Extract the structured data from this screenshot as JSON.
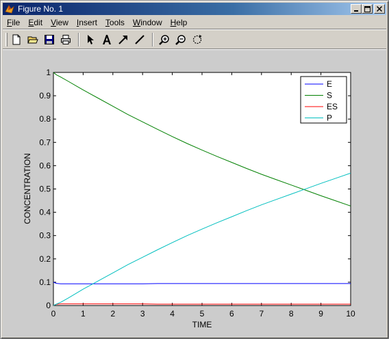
{
  "window": {
    "title": "Figure No. 1",
    "controls": {
      "minimize": "_",
      "maximize": "□",
      "close": "×"
    }
  },
  "menubar": {
    "items": [
      {
        "label": "File",
        "accel": "F"
      },
      {
        "label": "Edit",
        "accel": "E"
      },
      {
        "label": "View",
        "accel": "V"
      },
      {
        "label": "Insert",
        "accel": "I"
      },
      {
        "label": "Tools",
        "accel": "T"
      },
      {
        "label": "Window",
        "accel": "W"
      },
      {
        "label": "Help",
        "accel": "H"
      }
    ]
  },
  "toolbar": {
    "tools": [
      "new-file-icon",
      "open-folder-icon",
      "save-icon",
      "print-icon",
      "select-arrow-icon",
      "insert-text-icon",
      "insert-arrow-icon",
      "insert-line-icon",
      "zoom-in-icon",
      "zoom-out-icon",
      "rotate-icon"
    ]
  },
  "colors": {
    "E": "#0000ff",
    "S": "#008000",
    "ES": "#ff0000",
    "P": "#00bfbf",
    "figure_bg": "#cccccc",
    "axes_bg": "#ffffff"
  },
  "chart_data": {
    "type": "line",
    "title": "",
    "xlabel": "TIME",
    "ylabel": "CONCENTRATION",
    "xlim": [
      0,
      10
    ],
    "ylim": [
      0,
      1
    ],
    "xticks": [
      "0",
      "1",
      "2",
      "3",
      "4",
      "5",
      "6",
      "7",
      "8",
      "9",
      "10"
    ],
    "yticks": [
      "0",
      "0.1",
      "0.2",
      "0.3",
      "0.4",
      "0.5",
      "0.6",
      "0.7",
      "0.8",
      "0.9",
      "1"
    ],
    "legend_position": "top-right",
    "grid": false,
    "x": [
      0,
      0.1,
      0.25,
      0.5,
      1,
      1.5,
      2,
      2.5,
      3,
      3.5,
      4,
      4.5,
      5,
      5.5,
      6,
      6.5,
      7,
      7.5,
      8,
      8.5,
      9,
      9.5,
      10
    ],
    "series": [
      {
        "name": "E",
        "color": "#0000ff",
        "values": [
          0.1,
          0.095,
          0.093,
          0.093,
          0.093,
          0.093,
          0.093,
          0.093,
          0.093,
          0.094,
          0.094,
          0.094,
          0.094,
          0.094,
          0.094,
          0.094,
          0.094,
          0.094,
          0.094,
          0.094,
          0.094,
          0.094,
          0.094
        ]
      },
      {
        "name": "S",
        "color": "#008000",
        "values": [
          1.0,
          0.99,
          0.98,
          0.962,
          0.925,
          0.89,
          0.855,
          0.82,
          0.788,
          0.756,
          0.725,
          0.695,
          0.667,
          0.64,
          0.614,
          0.588,
          0.563,
          0.54,
          0.517,
          0.494,
          0.471,
          0.449,
          0.427
        ]
      },
      {
        "name": "ES",
        "color": "#ff0000",
        "values": [
          0.0,
          0.005,
          0.007,
          0.007,
          0.007,
          0.007,
          0.007,
          0.007,
          0.007,
          0.006,
          0.006,
          0.006,
          0.006,
          0.006,
          0.006,
          0.006,
          0.006,
          0.006,
          0.006,
          0.006,
          0.006,
          0.006,
          0.006
        ]
      },
      {
        "name": "P",
        "color": "#00bfbf",
        "values": [
          0.0,
          0.006,
          0.014,
          0.032,
          0.07,
          0.105,
          0.14,
          0.175,
          0.207,
          0.239,
          0.27,
          0.3,
          0.328,
          0.355,
          0.381,
          0.407,
          0.432,
          0.455,
          0.478,
          0.501,
          0.524,
          0.546,
          0.568
        ]
      }
    ]
  }
}
